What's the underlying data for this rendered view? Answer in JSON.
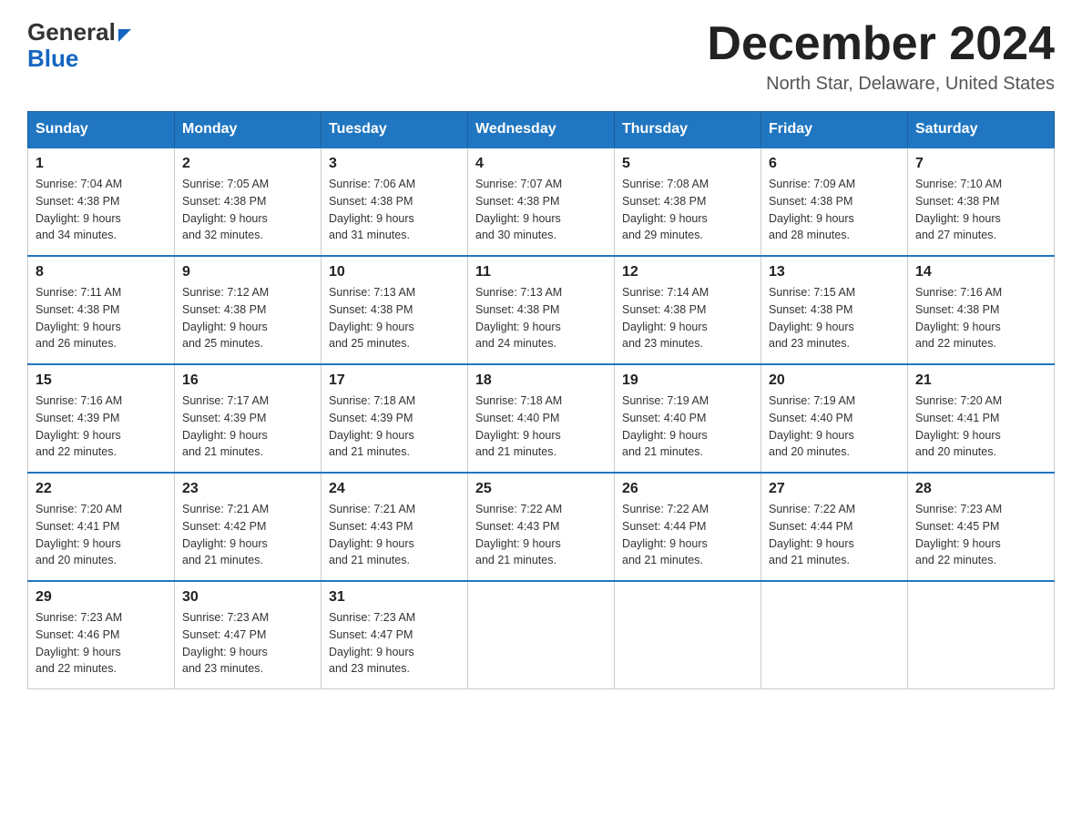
{
  "header": {
    "logo_general": "General",
    "logo_blue": "Blue",
    "title": "December 2024",
    "subtitle": "North Star, Delaware, United States"
  },
  "weekdays": [
    "Sunday",
    "Monday",
    "Tuesday",
    "Wednesday",
    "Thursday",
    "Friday",
    "Saturday"
  ],
  "weeks": [
    [
      {
        "day": "1",
        "sunrise": "7:04 AM",
        "sunset": "4:38 PM",
        "daylight": "9 hours and 34 minutes."
      },
      {
        "day": "2",
        "sunrise": "7:05 AM",
        "sunset": "4:38 PM",
        "daylight": "9 hours and 32 minutes."
      },
      {
        "day": "3",
        "sunrise": "7:06 AM",
        "sunset": "4:38 PM",
        "daylight": "9 hours and 31 minutes."
      },
      {
        "day": "4",
        "sunrise": "7:07 AM",
        "sunset": "4:38 PM",
        "daylight": "9 hours and 30 minutes."
      },
      {
        "day": "5",
        "sunrise": "7:08 AM",
        "sunset": "4:38 PM",
        "daylight": "9 hours and 29 minutes."
      },
      {
        "day": "6",
        "sunrise": "7:09 AM",
        "sunset": "4:38 PM",
        "daylight": "9 hours and 28 minutes."
      },
      {
        "day": "7",
        "sunrise": "7:10 AM",
        "sunset": "4:38 PM",
        "daylight": "9 hours and 27 minutes."
      }
    ],
    [
      {
        "day": "8",
        "sunrise": "7:11 AM",
        "sunset": "4:38 PM",
        "daylight": "9 hours and 26 minutes."
      },
      {
        "day": "9",
        "sunrise": "7:12 AM",
        "sunset": "4:38 PM",
        "daylight": "9 hours and 25 minutes."
      },
      {
        "day": "10",
        "sunrise": "7:13 AM",
        "sunset": "4:38 PM",
        "daylight": "9 hours and 25 minutes."
      },
      {
        "day": "11",
        "sunrise": "7:13 AM",
        "sunset": "4:38 PM",
        "daylight": "9 hours and 24 minutes."
      },
      {
        "day": "12",
        "sunrise": "7:14 AM",
        "sunset": "4:38 PM",
        "daylight": "9 hours and 23 minutes."
      },
      {
        "day": "13",
        "sunrise": "7:15 AM",
        "sunset": "4:38 PM",
        "daylight": "9 hours and 23 minutes."
      },
      {
        "day": "14",
        "sunrise": "7:16 AM",
        "sunset": "4:38 PM",
        "daylight": "9 hours and 22 minutes."
      }
    ],
    [
      {
        "day": "15",
        "sunrise": "7:16 AM",
        "sunset": "4:39 PM",
        "daylight": "9 hours and 22 minutes."
      },
      {
        "day": "16",
        "sunrise": "7:17 AM",
        "sunset": "4:39 PM",
        "daylight": "9 hours and 21 minutes."
      },
      {
        "day": "17",
        "sunrise": "7:18 AM",
        "sunset": "4:39 PM",
        "daylight": "9 hours and 21 minutes."
      },
      {
        "day": "18",
        "sunrise": "7:18 AM",
        "sunset": "4:40 PM",
        "daylight": "9 hours and 21 minutes."
      },
      {
        "day": "19",
        "sunrise": "7:19 AM",
        "sunset": "4:40 PM",
        "daylight": "9 hours and 21 minutes."
      },
      {
        "day": "20",
        "sunrise": "7:19 AM",
        "sunset": "4:40 PM",
        "daylight": "9 hours and 20 minutes."
      },
      {
        "day": "21",
        "sunrise": "7:20 AM",
        "sunset": "4:41 PM",
        "daylight": "9 hours and 20 minutes."
      }
    ],
    [
      {
        "day": "22",
        "sunrise": "7:20 AM",
        "sunset": "4:41 PM",
        "daylight": "9 hours and 20 minutes."
      },
      {
        "day": "23",
        "sunrise": "7:21 AM",
        "sunset": "4:42 PM",
        "daylight": "9 hours and 21 minutes."
      },
      {
        "day": "24",
        "sunrise": "7:21 AM",
        "sunset": "4:43 PM",
        "daylight": "9 hours and 21 minutes."
      },
      {
        "day": "25",
        "sunrise": "7:22 AM",
        "sunset": "4:43 PM",
        "daylight": "9 hours and 21 minutes."
      },
      {
        "day": "26",
        "sunrise": "7:22 AM",
        "sunset": "4:44 PM",
        "daylight": "9 hours and 21 minutes."
      },
      {
        "day": "27",
        "sunrise": "7:22 AM",
        "sunset": "4:44 PM",
        "daylight": "9 hours and 21 minutes."
      },
      {
        "day": "28",
        "sunrise": "7:23 AM",
        "sunset": "4:45 PM",
        "daylight": "9 hours and 22 minutes."
      }
    ],
    [
      {
        "day": "29",
        "sunrise": "7:23 AM",
        "sunset": "4:46 PM",
        "daylight": "9 hours and 22 minutes."
      },
      {
        "day": "30",
        "sunrise": "7:23 AM",
        "sunset": "4:47 PM",
        "daylight": "9 hours and 23 minutes."
      },
      {
        "day": "31",
        "sunrise": "7:23 AM",
        "sunset": "4:47 PM",
        "daylight": "9 hours and 23 minutes."
      },
      null,
      null,
      null,
      null
    ]
  ],
  "labels": {
    "sunrise": "Sunrise:",
    "sunset": "Sunset:",
    "daylight": "Daylight:"
  }
}
